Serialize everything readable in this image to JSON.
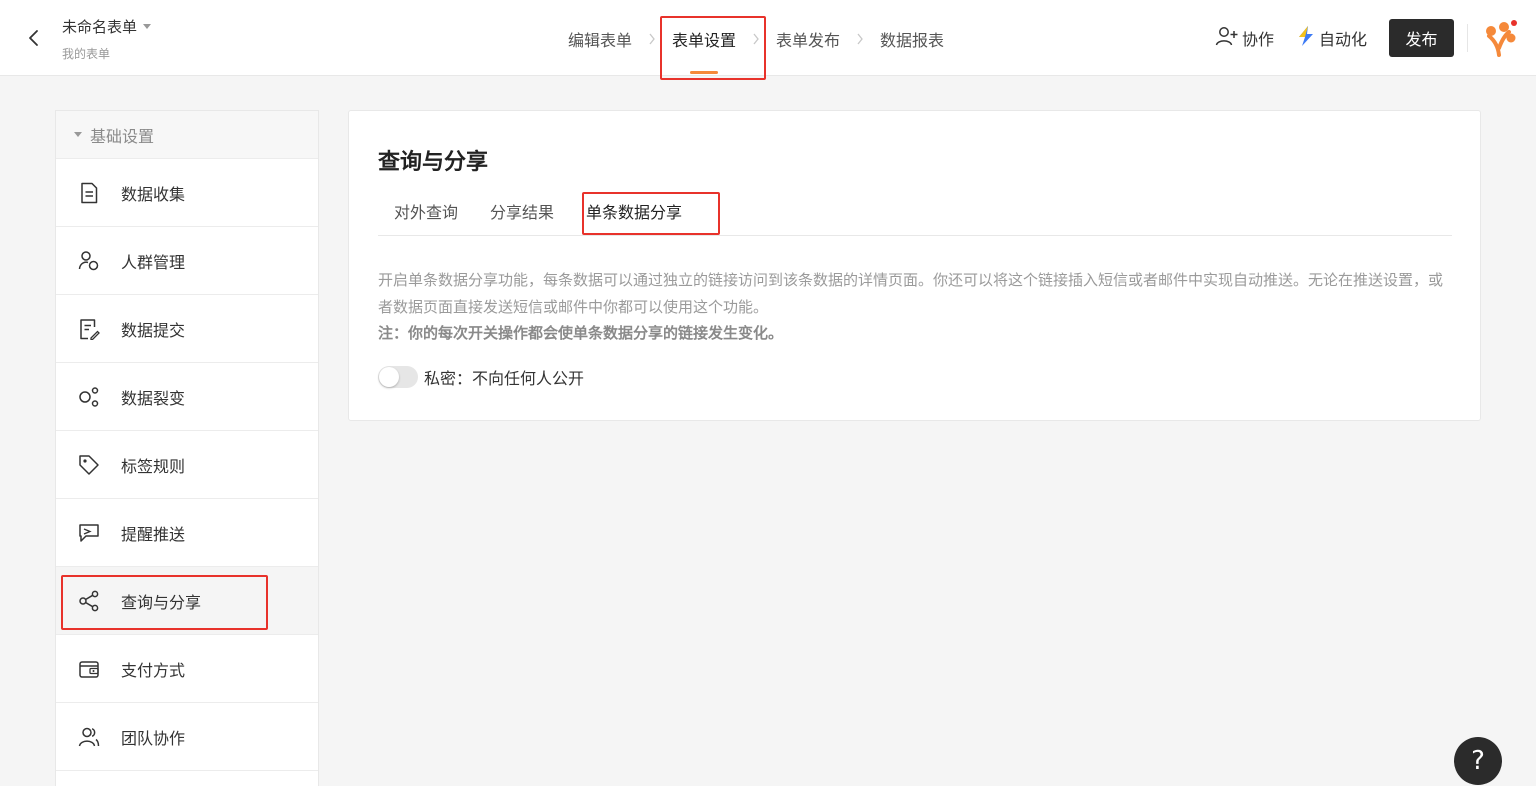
{
  "header": {
    "form_title": "未命名表单",
    "form_subtitle": "我的表单",
    "steps": [
      {
        "label": "编辑表单"
      },
      {
        "label": "表单设置"
      },
      {
        "label": "表单发布"
      },
      {
        "label": "数据报表"
      }
    ],
    "active_step": "表单设置",
    "collaborate_label": "协作",
    "automation_label": "自动化",
    "publish_label": "发布",
    "icons": {
      "back": "chevron-left-icon",
      "collaborate": "user-add-icon",
      "automation": "lightning-icon",
      "logo": "brand-logo-icon"
    }
  },
  "sidebar": {
    "group_label": "基础设置",
    "items": [
      {
        "label": "数据收集",
        "icon": "document-icon"
      },
      {
        "label": "人群管理",
        "icon": "user-group-icon"
      },
      {
        "label": "数据提交",
        "icon": "document-edit-icon"
      },
      {
        "label": "数据裂变",
        "icon": "fission-icon"
      },
      {
        "label": "标签规则",
        "icon": "tag-icon"
      },
      {
        "label": "提醒推送",
        "icon": "send-icon"
      },
      {
        "label": "查询与分享",
        "icon": "share-icon"
      },
      {
        "label": "支付方式",
        "icon": "wallet-icon"
      },
      {
        "label": "团队协作",
        "icon": "team-icon"
      }
    ],
    "active_item": "查询与分享"
  },
  "content": {
    "title": "查询与分享",
    "tabs": [
      {
        "label": "对外查询"
      },
      {
        "label": "分享结果"
      },
      {
        "label": "单条数据分享"
      }
    ],
    "active_tab": "单条数据分享",
    "description": "开启单条数据分享功能，每条数据可以通过独立的链接访问到该条数据的详情页面。你还可以将这个链接插入短信或者邮件中实现自动推送。无论在推送设置，或者数据页面直接发送短信或邮件中你都可以使用这个功能。",
    "note": "注：你的每次开关操作都会使单条数据分享的链接发生变化。",
    "toggle": {
      "label": "私密：不向任何人公开",
      "on": false
    }
  },
  "help_label": "?",
  "colors": {
    "accent": "#f5893a",
    "highlight": "#e8322b",
    "publish_bg": "#2b2b2b"
  }
}
